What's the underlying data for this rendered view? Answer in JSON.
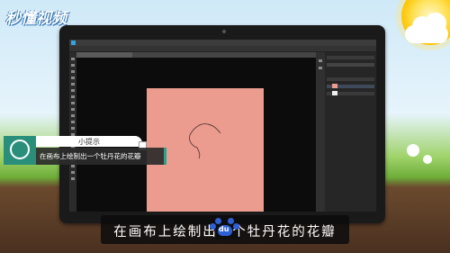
{
  "brand": {
    "logo_text": "秒懂视频"
  },
  "photoshop": {
    "menu_items": [
      "",
      "",
      "",
      "",
      "",
      "",
      "",
      "",
      "",
      ""
    ],
    "document_tab": "",
    "canvas_color": "#ec9c8e"
  },
  "tip": {
    "title": "小提示",
    "text": "在画布上绘制出一个牡丹花的花瓣",
    "accent_color": "#2aa38a"
  },
  "subtitle": {
    "text": "在画布上绘制出一个牡丹花的花瓣",
    "watermark_text": "du"
  }
}
